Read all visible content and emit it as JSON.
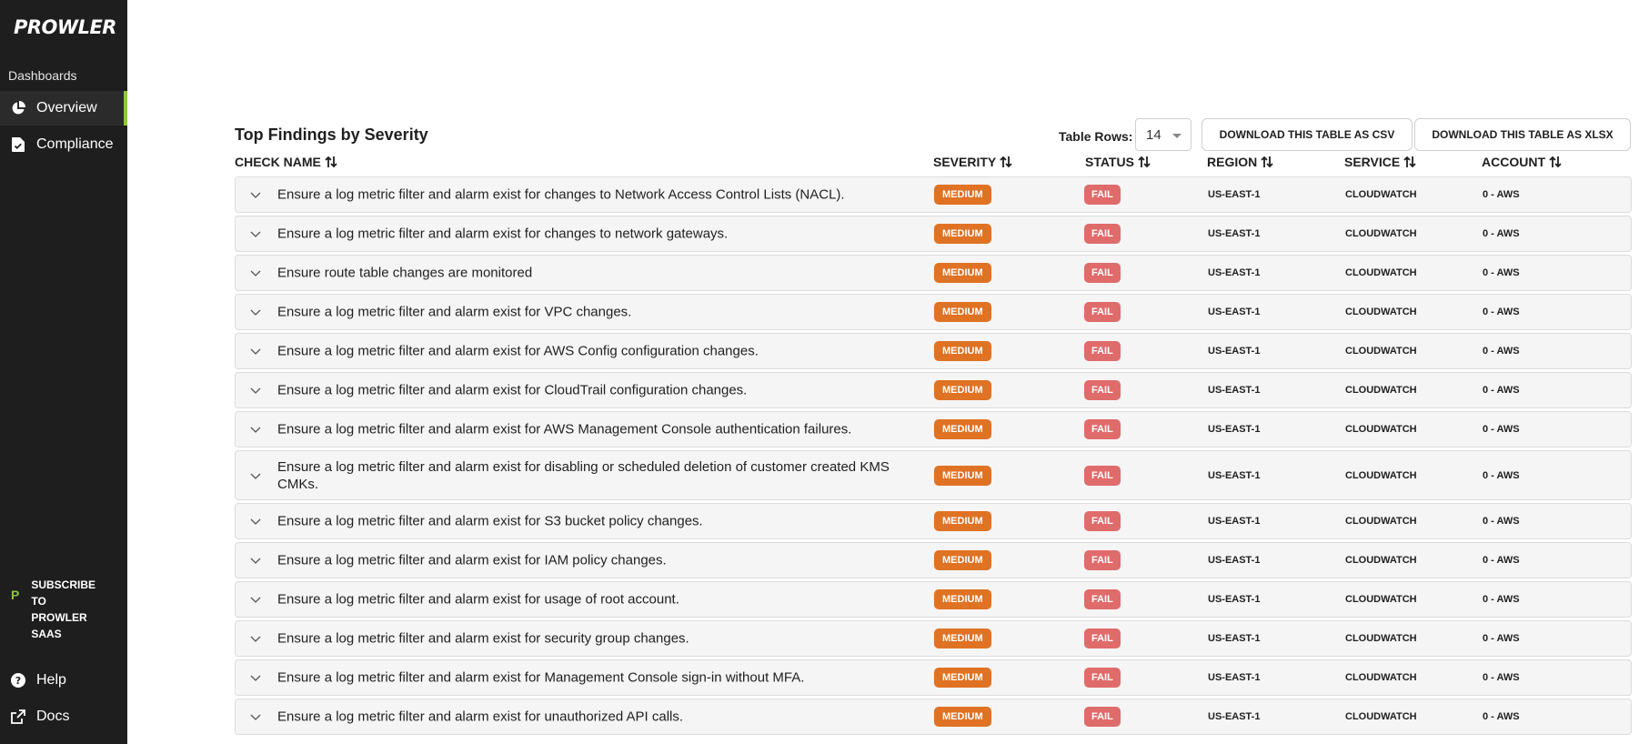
{
  "sidebar": {
    "logo": "PROWLER",
    "section_label": "Dashboards",
    "nav": [
      {
        "label": "Overview",
        "icon": "pie-chart-icon",
        "active": true
      },
      {
        "label": "Compliance",
        "icon": "document-check-icon",
        "active": false
      }
    ],
    "subscribe_lines": [
      "SUBSCRIBE TO",
      "PROWLER",
      "SAAS"
    ],
    "help_label": "Help",
    "docs_label": "Docs"
  },
  "main": {
    "title": "Top Findings by Severity",
    "table_rows_label": "Table Rows:",
    "table_rows_value": "14",
    "download_csv": "DOWNLOAD THIS TABLE AS CSV",
    "download_xlsx": "DOWNLOAD THIS TABLE AS XLSX",
    "columns": [
      "CHECK NAME",
      "SEVERITY",
      "STATUS",
      "REGION",
      "SERVICE",
      "ACCOUNT"
    ],
    "rows": [
      {
        "check": "Ensure a log metric filter and alarm exist for changes to Network Access Control Lists (NACL).",
        "severity": "MEDIUM",
        "status": "FAIL",
        "region": "US-EAST-1",
        "service": "CLOUDWATCH",
        "account": "0 - AWS"
      },
      {
        "check": "Ensure a log metric filter and alarm exist for changes to network gateways.",
        "severity": "MEDIUM",
        "status": "FAIL",
        "region": "US-EAST-1",
        "service": "CLOUDWATCH",
        "account": "0 - AWS"
      },
      {
        "check": "Ensure route table changes are monitored",
        "severity": "MEDIUM",
        "status": "FAIL",
        "region": "US-EAST-1",
        "service": "CLOUDWATCH",
        "account": "0 - AWS"
      },
      {
        "check": "Ensure a log metric filter and alarm exist for VPC changes.",
        "severity": "MEDIUM",
        "status": "FAIL",
        "region": "US-EAST-1",
        "service": "CLOUDWATCH",
        "account": "0 - AWS"
      },
      {
        "check": "Ensure a log metric filter and alarm exist for AWS Config configuration changes.",
        "severity": "MEDIUM",
        "status": "FAIL",
        "region": "US-EAST-1",
        "service": "CLOUDWATCH",
        "account": "0 - AWS"
      },
      {
        "check": "Ensure a log metric filter and alarm exist for CloudTrail configuration changes.",
        "severity": "MEDIUM",
        "status": "FAIL",
        "region": "US-EAST-1",
        "service": "CLOUDWATCH",
        "account": "0 - AWS"
      },
      {
        "check": "Ensure a log metric filter and alarm exist for AWS Management Console authentication failures.",
        "severity": "MEDIUM",
        "status": "FAIL",
        "region": "US-EAST-1",
        "service": "CLOUDWATCH",
        "account": "0 - AWS"
      },
      {
        "check": "Ensure a log metric filter and alarm exist for disabling or scheduled deletion of customer created KMS CMKs.",
        "severity": "MEDIUM",
        "status": "FAIL",
        "region": "US-EAST-1",
        "service": "CLOUDWATCH",
        "account": "0 - AWS"
      },
      {
        "check": "Ensure a log metric filter and alarm exist for S3 bucket policy changes.",
        "severity": "MEDIUM",
        "status": "FAIL",
        "region": "US-EAST-1",
        "service": "CLOUDWATCH",
        "account": "0 - AWS"
      },
      {
        "check": "Ensure a log metric filter and alarm exist for IAM policy changes.",
        "severity": "MEDIUM",
        "status": "FAIL",
        "region": "US-EAST-1",
        "service": "CLOUDWATCH",
        "account": "0 - AWS"
      },
      {
        "check": "Ensure a log metric filter and alarm exist for usage of root account.",
        "severity": "MEDIUM",
        "status": "FAIL",
        "region": "US-EAST-1",
        "service": "CLOUDWATCH",
        "account": "0 - AWS"
      },
      {
        "check": "Ensure a log metric filter and alarm exist for security group changes.",
        "severity": "MEDIUM",
        "status": "FAIL",
        "region": "US-EAST-1",
        "service": "CLOUDWATCH",
        "account": "0 - AWS"
      },
      {
        "check": "Ensure a log metric filter and alarm exist for Management Console sign-in without MFA.",
        "severity": "MEDIUM",
        "status": "FAIL",
        "region": "US-EAST-1",
        "service": "CLOUDWATCH",
        "account": "0 - AWS"
      },
      {
        "check": "Ensure a log metric filter and alarm exist for unauthorized API calls.",
        "severity": "MEDIUM",
        "status": "FAIL",
        "region": "US-EAST-1",
        "service": "CLOUDWATCH",
        "account": "0 - AWS"
      }
    ]
  },
  "colors": {
    "sidebar_bg": "#1e1e1e",
    "accent": "#8dc63f",
    "severity_medium": "#e07224",
    "status_fail": "#e06b6b"
  }
}
